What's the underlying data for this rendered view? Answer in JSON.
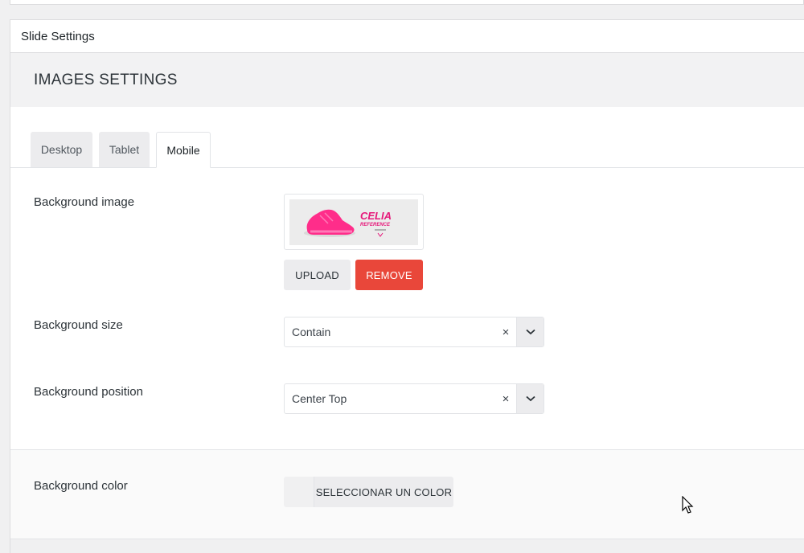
{
  "panel": {
    "title": "Slide Settings"
  },
  "section": {
    "title": "IMAGES SETTINGS"
  },
  "tabs": [
    {
      "label": "Desktop",
      "active": false
    },
    {
      "label": "Tablet",
      "active": false
    },
    {
      "label": "Mobile",
      "active": true
    }
  ],
  "background_image": {
    "label": "Background image",
    "thumbnail": {
      "brand_text": "CELIA",
      "sub_text": "REFERENCE",
      "shoe_color": "#ff2d8a"
    },
    "upload_label": "UPLOAD",
    "remove_label": "REMOVE"
  },
  "background_size": {
    "label": "Background size",
    "value": "Contain",
    "clear": "×"
  },
  "background_position": {
    "label": "Background position",
    "value": "Center Top",
    "clear": "×"
  },
  "background_color": {
    "label": "Background color",
    "button_label": "SELECCIONAR UN COLOR"
  },
  "colors": {
    "remove": "#e9473a",
    "accent_pink": "#e6197a"
  }
}
